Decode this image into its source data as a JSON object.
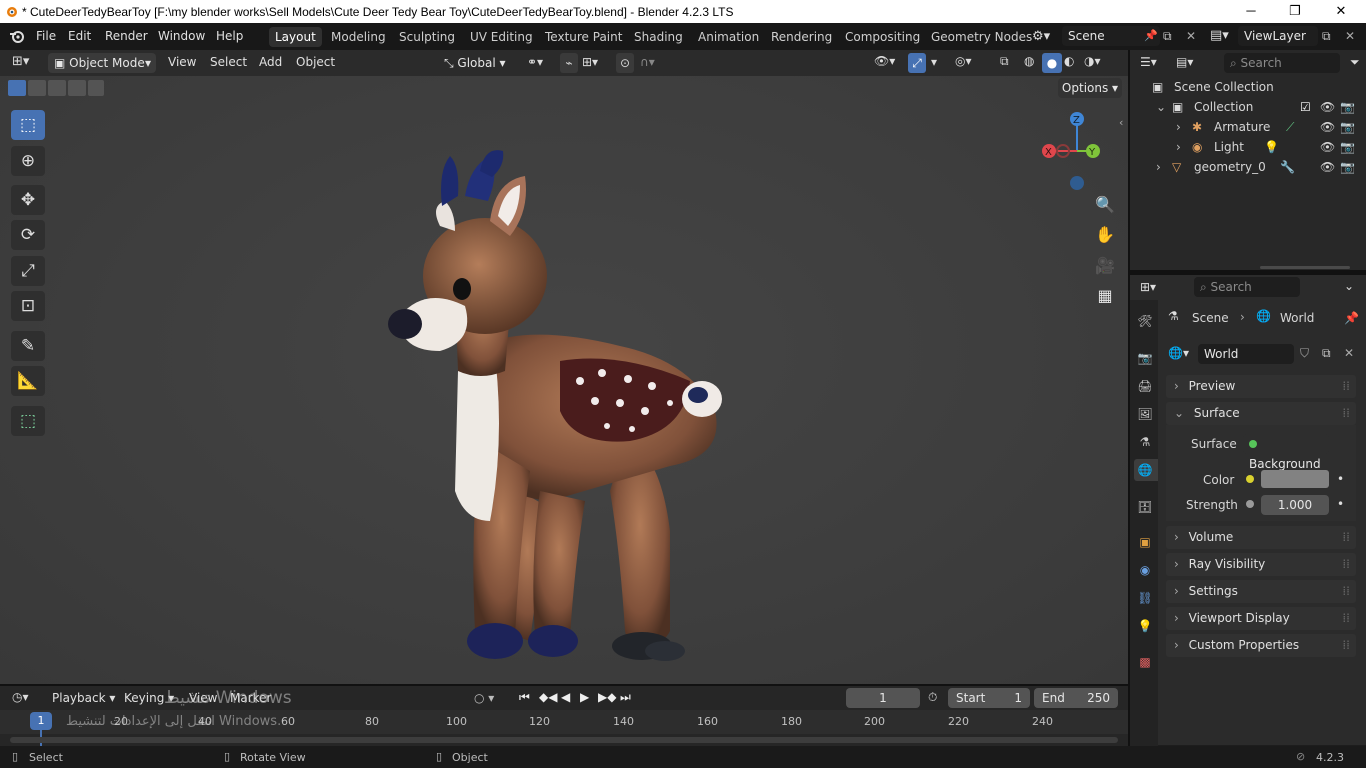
{
  "window": {
    "title": "* CuteDeerTedyBearToy [F:\\my blender works\\Sell Models\\Cute Deer Tedy Bear Toy\\CuteDeerTedyBearToy.blend] - Blender 4.2.3 LTS",
    "minimize": "─",
    "maximize": "❐",
    "close": "✕"
  },
  "menu": {
    "file": "File",
    "edit": "Edit",
    "render": "Render",
    "window": "Window",
    "help": "Help"
  },
  "workspaces": [
    "Layout",
    "Modeling",
    "Sculpting",
    "UV Editing",
    "Texture Paint",
    "Shading",
    "Animation",
    "Rendering",
    "Compositing",
    "Geometry Nodes"
  ],
  "scene": {
    "name": "Scene",
    "view_layer": "ViewLayer"
  },
  "viewport": {
    "mode": "Object Mode",
    "menus": [
      "View",
      "Select",
      "Add",
      "Object"
    ],
    "transform_orientation": "Global",
    "options": "Options",
    "gizmo": {
      "x": "X",
      "y": "Y",
      "z": "Z"
    }
  },
  "outliner": {
    "search_placeholder": "Search",
    "items": [
      "Scene Collection",
      "Collection",
      "Armature",
      "Light",
      "geometry_0"
    ]
  },
  "properties": {
    "search_placeholder": "Search",
    "breadcrumb_scene": "Scene",
    "breadcrumb_world": "World",
    "world_name": "World",
    "panels": [
      "Preview",
      "Surface",
      "Volume",
      "Ray Visibility",
      "Settings",
      "Viewport Display",
      "Custom Properties"
    ],
    "surface_label": "Surface",
    "surface_value": "Background",
    "color_label": "Color",
    "strength_label": "Strength",
    "strength_value": "1.000"
  },
  "timeline": {
    "menus": [
      "Playback",
      "Keying",
      "View",
      "Marker"
    ],
    "current_frame": "1",
    "start_label": "Start",
    "start_value": "1",
    "end_label": "End",
    "end_value": "250",
    "ticks": [
      "1",
      "20",
      "40",
      "60",
      "80",
      "100",
      "120",
      "140",
      "160",
      "180",
      "200",
      "220",
      "240"
    ],
    "watermark_1": "تنشيط Windows",
    "watermark_2": "انتقل إلى الإعدادات لتنشيط Windows."
  },
  "statusbar": {
    "select": "Select",
    "rotate": "Rotate View",
    "object": "Object",
    "version": "4.2.3"
  },
  "colors": {
    "accent": "#4772b3",
    "axis_x": "#e0464c",
    "axis_y": "#7fc43a",
    "axis_z": "#3f86d6",
    "surface_dot": "#57c55a",
    "color_dot": "#d9d12f"
  }
}
